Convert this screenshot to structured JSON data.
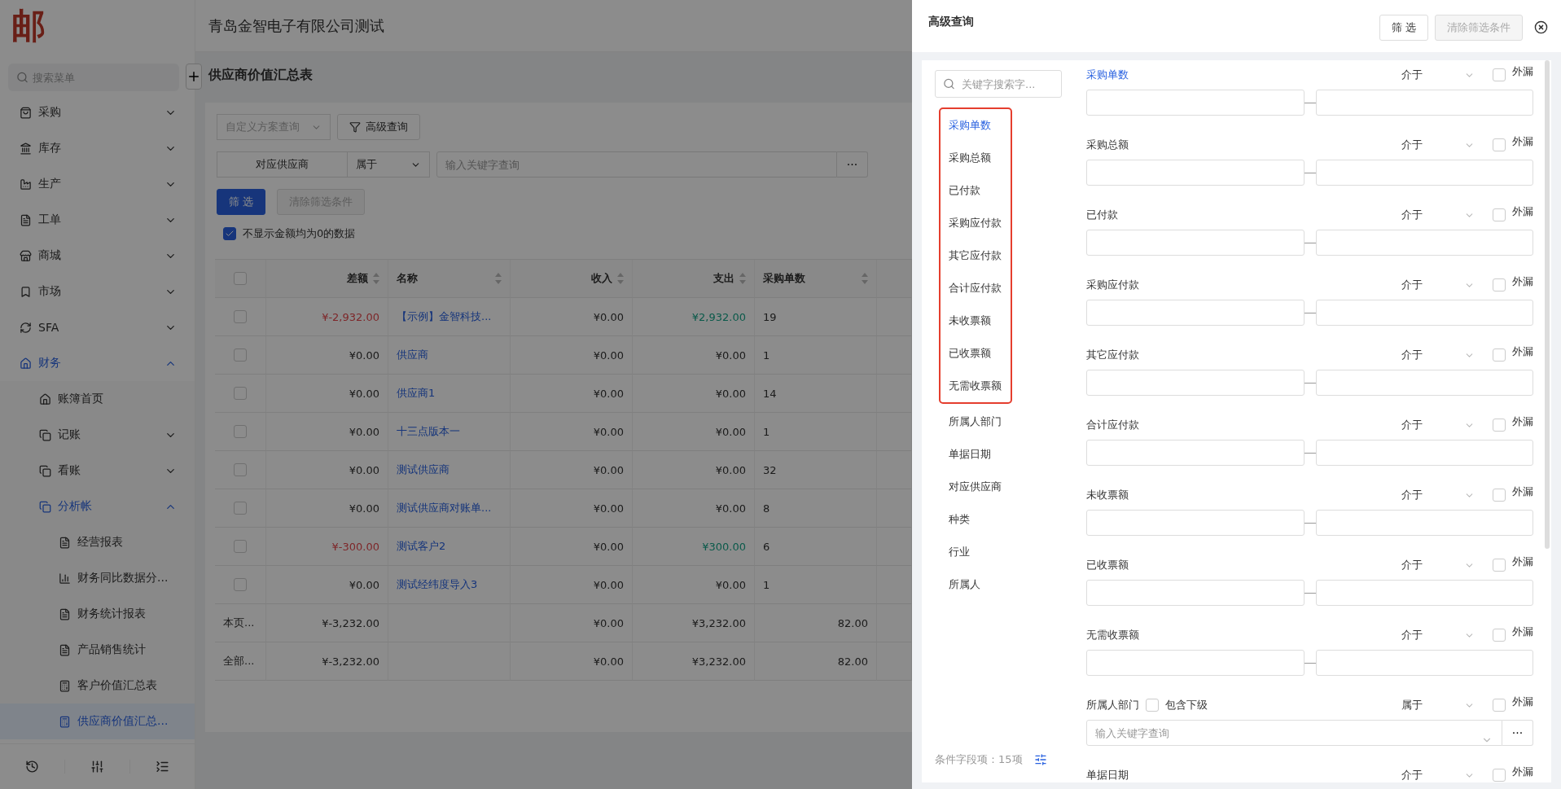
{
  "app": {
    "logo": "邮",
    "company": "青岛金智电子有限公司测试"
  },
  "sidebar": {
    "search_placeholder": "搜索菜单",
    "nav": [
      {
        "label": "采购",
        "expanded": false
      },
      {
        "label": "库存",
        "expanded": false
      },
      {
        "label": "生产",
        "expanded": false
      },
      {
        "label": "工单",
        "expanded": false
      },
      {
        "label": "商城",
        "expanded": false
      },
      {
        "label": "市场",
        "expanded": false
      },
      {
        "label": "SFA",
        "expanded": false
      },
      {
        "label": "财务",
        "expanded": true,
        "children": [
          {
            "label": "账簿首页",
            "selected": false
          },
          {
            "label": "记账",
            "expanded": false
          },
          {
            "label": "看账",
            "expanded": false
          },
          {
            "label": "分析帐",
            "expanded": true,
            "children": [
              {
                "label": "经营报表",
                "selected": false
              },
              {
                "label": "财务同比数据分...",
                "selected": false
              },
              {
                "label": "财务统计报表",
                "selected": false
              },
              {
                "label": "产品销售统计",
                "selected": false
              },
              {
                "label": "客户价值汇总表",
                "selected": false
              },
              {
                "label": "供应商价值汇总...",
                "selected": true
              }
            ]
          }
        ]
      }
    ]
  },
  "page": {
    "title": "供应商价值汇总表",
    "scheme_placeholder": "自定义方案查询",
    "advanced_button": "高级查询",
    "filter": {
      "field": "对应供应商",
      "operator": "属于",
      "placeholder": "输入关键字查询",
      "more": "···"
    },
    "filter_button": "筛 选",
    "clear_button": "清除筛选条件",
    "hide_zero": {
      "label": "不显示金额均为0的数据",
      "checked": true
    },
    "table": {
      "all_selected": false,
      "columns": [
        "差额",
        "名称",
        "收入",
        "支出",
        "采购单数"
      ],
      "rows": [
        {
          "kind": "data",
          "selected": false,
          "diff": {
            "text": "¥-2,932.00",
            "negative": true
          },
          "name": "【示例】金智科技...",
          "income": "¥0.00",
          "expense": {
            "text": "¥2,932.00",
            "positive": true
          },
          "count": "19"
        },
        {
          "kind": "data",
          "selected": false,
          "diff": {
            "text": "¥0.00",
            "negative": false
          },
          "name": "供应商",
          "income": "¥0.00",
          "expense": {
            "text": "¥0.00",
            "positive": false
          },
          "count": "1"
        },
        {
          "kind": "data",
          "selected": false,
          "diff": {
            "text": "¥0.00",
            "negative": false
          },
          "name": "供应商1",
          "income": "¥0.00",
          "expense": {
            "text": "¥0.00",
            "positive": false
          },
          "count": "14"
        },
        {
          "kind": "data",
          "selected": false,
          "diff": {
            "text": "¥0.00",
            "negative": false
          },
          "name": "十三点版本一",
          "income": "¥0.00",
          "expense": {
            "text": "¥0.00",
            "positive": false
          },
          "count": "1"
        },
        {
          "kind": "data",
          "selected": false,
          "diff": {
            "text": "¥0.00",
            "negative": false
          },
          "name": "测试供应商",
          "income": "¥0.00",
          "expense": {
            "text": "¥0.00",
            "positive": false
          },
          "count": "32"
        },
        {
          "kind": "data",
          "selected": false,
          "diff": {
            "text": "¥0.00",
            "negative": false
          },
          "name": "测试供应商对账单...",
          "income": "¥0.00",
          "expense": {
            "text": "¥0.00",
            "positive": false
          },
          "count": "8"
        },
        {
          "kind": "data",
          "selected": false,
          "diff": {
            "text": "¥-300.00",
            "negative": true
          },
          "name": "测试客户2",
          "income": "¥0.00",
          "expense": {
            "text": "¥300.00",
            "positive": true
          },
          "count": "6"
        },
        {
          "kind": "data",
          "selected": false,
          "diff": {
            "text": "¥0.00",
            "negative": false
          },
          "name": "测试经纬度导入3",
          "income": "¥0.00",
          "expense": {
            "text": "¥0.00",
            "positive": false
          },
          "count": "1"
        },
        {
          "kind": "summary",
          "label": "本页...",
          "diff": "¥-3,232.00",
          "income": "¥0.00",
          "expense": "¥3,232.00",
          "count": "82.00"
        },
        {
          "kind": "summary",
          "label": "全部...",
          "diff": "¥-3,232.00",
          "income": "¥0.00",
          "expense": "¥3,232.00",
          "count": "82.00"
        }
      ]
    }
  },
  "drawer": {
    "title": "高级查询",
    "filter_button": "筛 选",
    "clear_button": "清除筛选条件",
    "clear_disabled": true,
    "field_search_placeholder": "关键字搜索字...",
    "field_groups": [
      {
        "highlighted": true,
        "fields": [
          {
            "label": "采购单数",
            "selected": true
          },
          {
            "label": "采购总额",
            "selected": false
          },
          {
            "label": "已付款",
            "selected": false
          },
          {
            "label": "采购应付款",
            "selected": false
          },
          {
            "label": "其它应付款",
            "selected": false
          },
          {
            "label": "合计应付款",
            "selected": false
          },
          {
            "label": "未收票额",
            "selected": false
          },
          {
            "label": "已收票额",
            "selected": false
          },
          {
            "label": "无需收票额",
            "selected": false
          }
        ]
      },
      {
        "highlighted": false,
        "fields": [
          {
            "label": "所属人部门",
            "selected": false
          },
          {
            "label": "单据日期",
            "selected": false
          },
          {
            "label": "对应供应商",
            "selected": false
          },
          {
            "label": "种类",
            "selected": false
          },
          {
            "label": "行业",
            "selected": false
          },
          {
            "label": "所属人",
            "selected": false
          }
        ]
      }
    ],
    "field_count": "条件字段项：15项",
    "conditions": [
      {
        "kind": "range",
        "label": "采购单数",
        "selected": true,
        "operator": "介于",
        "exclude_label": "外漏",
        "exclude": false
      },
      {
        "kind": "range",
        "label": "采购总额",
        "selected": false,
        "operator": "介于",
        "exclude_label": "外漏",
        "exclude": false
      },
      {
        "kind": "range",
        "label": "已付款",
        "selected": false,
        "operator": "介于",
        "exclude_label": "外漏",
        "exclude": false
      },
      {
        "kind": "range",
        "label": "采购应付款",
        "selected": false,
        "operator": "介于",
        "exclude_label": "外漏",
        "exclude": false
      },
      {
        "kind": "range",
        "label": "其它应付款",
        "selected": false,
        "operator": "介于",
        "exclude_label": "外漏",
        "exclude": false
      },
      {
        "kind": "range",
        "label": "合计应付款",
        "selected": false,
        "operator": "介于",
        "exclude_label": "外漏",
        "exclude": false
      },
      {
        "kind": "range",
        "label": "未收票额",
        "selected": false,
        "operator": "介于",
        "exclude_label": "外漏",
        "exclude": false
      },
      {
        "kind": "range",
        "label": "已收票额",
        "selected": false,
        "operator": "介于",
        "exclude_label": "外漏",
        "exclude": false
      },
      {
        "kind": "range",
        "label": "无需收票额",
        "selected": false,
        "operator": "介于",
        "exclude_label": "外漏",
        "exclude": false
      },
      {
        "kind": "select",
        "label": "所属人部门",
        "selected": false,
        "sub_label": "包含下级",
        "sub_checked": false,
        "operator": "属于",
        "exclude_label": "外漏",
        "exclude": false,
        "placeholder": "输入关键字查询",
        "more": "···"
      },
      {
        "kind": "range",
        "label": "单据日期",
        "selected": false,
        "operator": "介于",
        "exclude_label": "外漏",
        "exclude": false
      }
    ]
  }
}
